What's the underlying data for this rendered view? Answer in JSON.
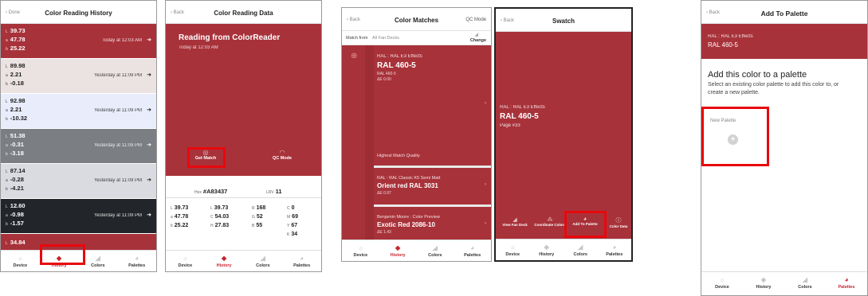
{
  "colors": {
    "brand": "#a8323a",
    "highlight": "#e8080d",
    "tab_active": "#c6252d"
  },
  "tabs": [
    "Device",
    "History",
    "Colors",
    "Palettes"
  ],
  "tab_icons": {
    "device": "sun-icon",
    "history": "layers-icon",
    "colors": "fan-deck-icon",
    "palettes": "palette-icon"
  },
  "screen1": {
    "back": "Done",
    "title": "Color Reading History",
    "rows": [
      {
        "l": "39.73",
        "a": "47.78",
        "b": "25.22",
        "time": "Today at 12:03 AM",
        "bg": "#a8323a",
        "fg": "#ffffff"
      },
      {
        "l": "89.98",
        "a": "2.21",
        "b": "-0.18",
        "time": "Yesterday at 11:09 PM",
        "bg": "#ebe3e2",
        "fg": "#222222"
      },
      {
        "l": "92.98",
        "a": "2.21",
        "b": "-10.32",
        "time": "Yesterday at 11:09 PM",
        "bg": "#e9ecfb",
        "fg": "#222222"
      },
      {
        "l": "51.38",
        "a": "-0.31",
        "b": "-3.18",
        "time": "Yesterday at 11:09 PM",
        "bg": "#7b7e83",
        "fg": "#ffffff"
      },
      {
        "l": "87.14",
        "a": "-0.28",
        "b": "-4.21",
        "time": "Yesterday at 11:09 PM",
        "bg": "#d9dbe0",
        "fg": "#222222"
      },
      {
        "l": "12.60",
        "a": "-0.98",
        "b": "-1.57",
        "time": "Yesterday at 11:09 PM",
        "bg": "#22262a",
        "fg": "#ffffff"
      }
    ],
    "last_l": "34.84"
  },
  "screen2": {
    "back": "Back",
    "title": "Color Reading Data",
    "heading": "Reading from ColorReader",
    "time": "Today at 12:03 AM",
    "get_match": "Get Match",
    "qc_mode": "QC Mode",
    "hex_label": "Hex",
    "hex": "#A83437",
    "lrv_label": "LRV",
    "lrv": "11",
    "lab": {
      "l": "39.73",
      "a": "47.78",
      "b": "25.22"
    },
    "lch": {
      "l": "39.73",
      "c": "54.03",
      "h": "27.83"
    },
    "rgb": {
      "r": "168",
      "g": "52",
      "b": "55"
    },
    "cmyk": {
      "c": "0",
      "m": "69",
      "y": "67",
      "k": "34"
    }
  },
  "screen3": {
    "back": "Back",
    "title": "Color Matches",
    "right": "QC Mode",
    "match_from_label": "Match from",
    "match_from": "All Fan Decks",
    "change": "Change",
    "matches": [
      {
        "source": "RAL : RAL E3 Effects",
        "name": "RAL 460-5",
        "lines": [
          "RAL 460-5",
          "ΔE 0.00"
        ],
        "quality": "Highest Match Quality"
      },
      {
        "source": "RAL : RAL Classic K5 Semi Matt",
        "name": "Orient red RAL 3031",
        "lines": [
          "ΔE 0.97"
        ]
      },
      {
        "source": "Benjamin Moore : Color Preview",
        "name": "Exotic Red 2086-10",
        "lines": [
          "ΔE 1.43"
        ]
      }
    ]
  },
  "screen4": {
    "back": "Back",
    "title": "Swatch",
    "source": "RAL : RAL E3 Effects",
    "name": "RAL 460-5",
    "page": "Page #33",
    "actions": [
      "View Fan Deck",
      "Coordinate Colors",
      "Add To Palette",
      "Color Data"
    ]
  },
  "screen5": {
    "back": "Back",
    "title": "Add To Palette",
    "source": "RAL : RAL E3 Effects",
    "name": "RAL 460-5",
    "heading": "Add this color to a palette",
    "desc": "Select an existing color palette to add this color to, or create a new palette.",
    "new_palette": "New Palette"
  }
}
